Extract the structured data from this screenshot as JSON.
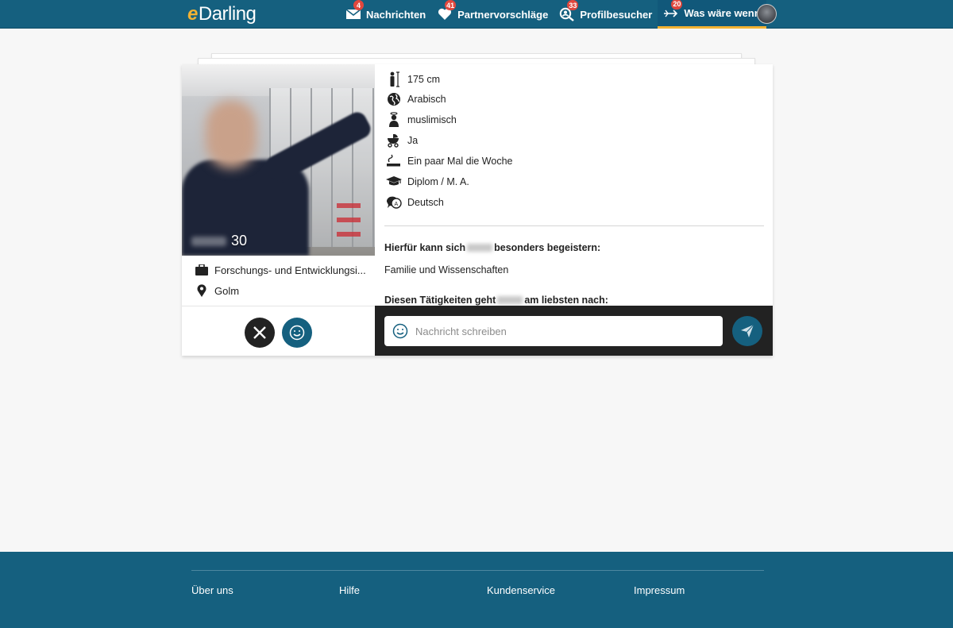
{
  "header": {
    "logo_prefix": "e",
    "logo_text": "Darling",
    "nav": [
      {
        "label": "Nachrichten",
        "badge": "4",
        "icon": "envelope-icon"
      },
      {
        "label": "Partnervorschläge",
        "badge": "41",
        "icon": "heart-icon"
      },
      {
        "label": "Profilbesucher",
        "badge": "33",
        "icon": "visitor-search-icon"
      },
      {
        "label": "Was wäre wenn",
        "badge": "20",
        "icon": "arrow-target-icon",
        "active": true
      }
    ]
  },
  "profile": {
    "age": "30",
    "occupation": "Forschungs- und Entwicklungsi...",
    "location": "Golm",
    "attributes": [
      {
        "icon": "height-icon",
        "value": "175 cm"
      },
      {
        "icon": "globe-icon",
        "value": "Arabisch"
      },
      {
        "icon": "religion-icon",
        "value": "muslimisch"
      },
      {
        "icon": "stroller-icon",
        "value": "Ja"
      },
      {
        "icon": "smoking-icon",
        "value": "Ein paar Mal die Woche"
      },
      {
        "icon": "graduation-cap-icon",
        "value": "Diplom / M. A."
      },
      {
        "icon": "language-icon",
        "value": "Deutsch"
      }
    ],
    "interests_heading_pre": "Hierfür kann sich",
    "interests_heading_post": "besonders begeistern:",
    "interests_text": "Familie und Wissenschaften",
    "activities_heading_pre": "Diesen Tätigkeiten geht",
    "activities_heading_post": "am liebsten nach:"
  },
  "compose": {
    "placeholder": "Nachricht schreiben"
  },
  "footer": {
    "links": [
      "Über uns",
      "Hilfe",
      "Kundenservice",
      "Impressum"
    ]
  },
  "colors": {
    "brand": "#15607f",
    "accent": "#f2b233",
    "badge": "#e0473d"
  }
}
